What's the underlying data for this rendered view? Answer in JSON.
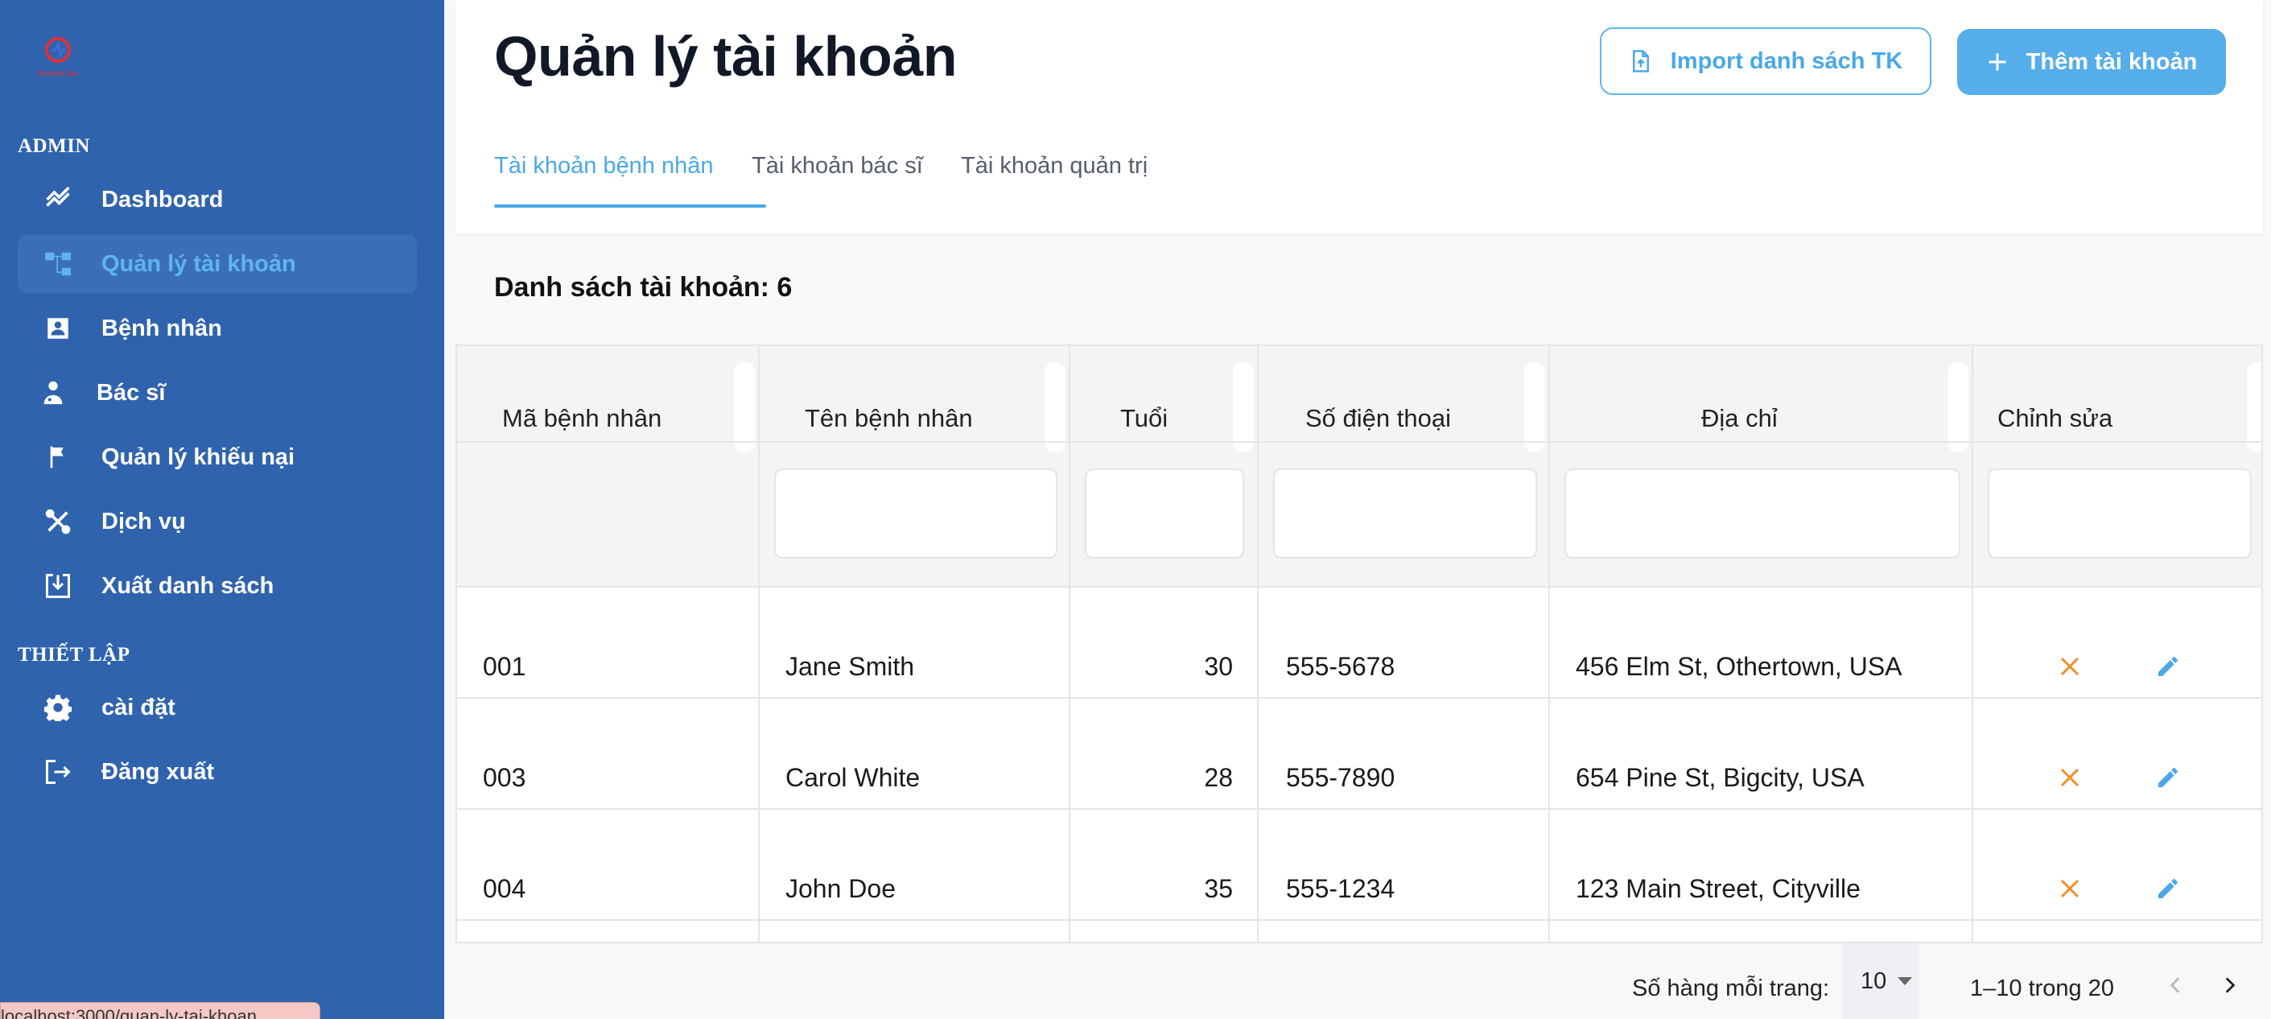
{
  "app": {
    "logo_text": "MedicalCare",
    "brand_colors": {
      "sidebar": "#2f63ad",
      "accent": "#4aa8e8",
      "delete": "#f28c28"
    }
  },
  "sidebar": {
    "section_admin": "ADMIN",
    "items": [
      {
        "label": "Dashboard",
        "icon": "chart-line-icon"
      },
      {
        "label": "Quản lý tài khoản",
        "icon": "account-tree-icon",
        "active": true
      },
      {
        "label": "Bệnh nhân",
        "icon": "patient-card-icon"
      },
      {
        "label": "Bác sĩ",
        "icon": "doctor-icon"
      },
      {
        "label": "Quản lý khiếu nại",
        "icon": "flag-icon"
      },
      {
        "label": "Dịch vụ",
        "icon": "tools-icon"
      },
      {
        "label": "Xuất danh sách",
        "icon": "download-icon"
      }
    ],
    "section_settings": "THIẾT LẬP",
    "settings_items": [
      {
        "label": "cài đặt",
        "icon": "gear-icon"
      },
      {
        "label": "Đăng xuất",
        "icon": "logout-icon"
      }
    ]
  },
  "status_bar": {
    "url": "localhost:3000/quan-ly-tai-khoan"
  },
  "header": {
    "title": "Quản lý tài khoản",
    "import_label": "Import danh sách TK",
    "add_label": "Thêm tài khoản",
    "tabs": [
      {
        "label": "Tài khoản bệnh nhân",
        "active": true
      },
      {
        "label": "Tài khoản bác sĩ"
      },
      {
        "label": "Tài khoản quản trị"
      }
    ]
  },
  "list": {
    "count_label": "Danh sách tài khoản: 6"
  },
  "table": {
    "columns": [
      "Mã bệnh nhân",
      "Tên bệnh nhân",
      "Tuổi",
      "Số điện thoại",
      "Địa chỉ",
      "Chỉnh sửa"
    ],
    "filters": [
      "",
      "",
      "",
      "",
      ""
    ],
    "rows": [
      {
        "id": "001",
        "name": "Jane Smith",
        "age": "30",
        "phone": "555-5678",
        "address": "456 Elm St, Othertown, USA"
      },
      {
        "id": "003",
        "name": "Carol White",
        "age": "28",
        "phone": "555-7890",
        "address": "654 Pine St, Bigcity, USA"
      },
      {
        "id": "004",
        "name": "John Doe",
        "age": "35",
        "phone": "555-1234",
        "address": "123 Main Street, Cityville"
      }
    ]
  },
  "pagination": {
    "rows_per_page_label": "Số hàng mỗi trang:",
    "rows_per_page": "10",
    "range": "1–10 trong 20"
  }
}
